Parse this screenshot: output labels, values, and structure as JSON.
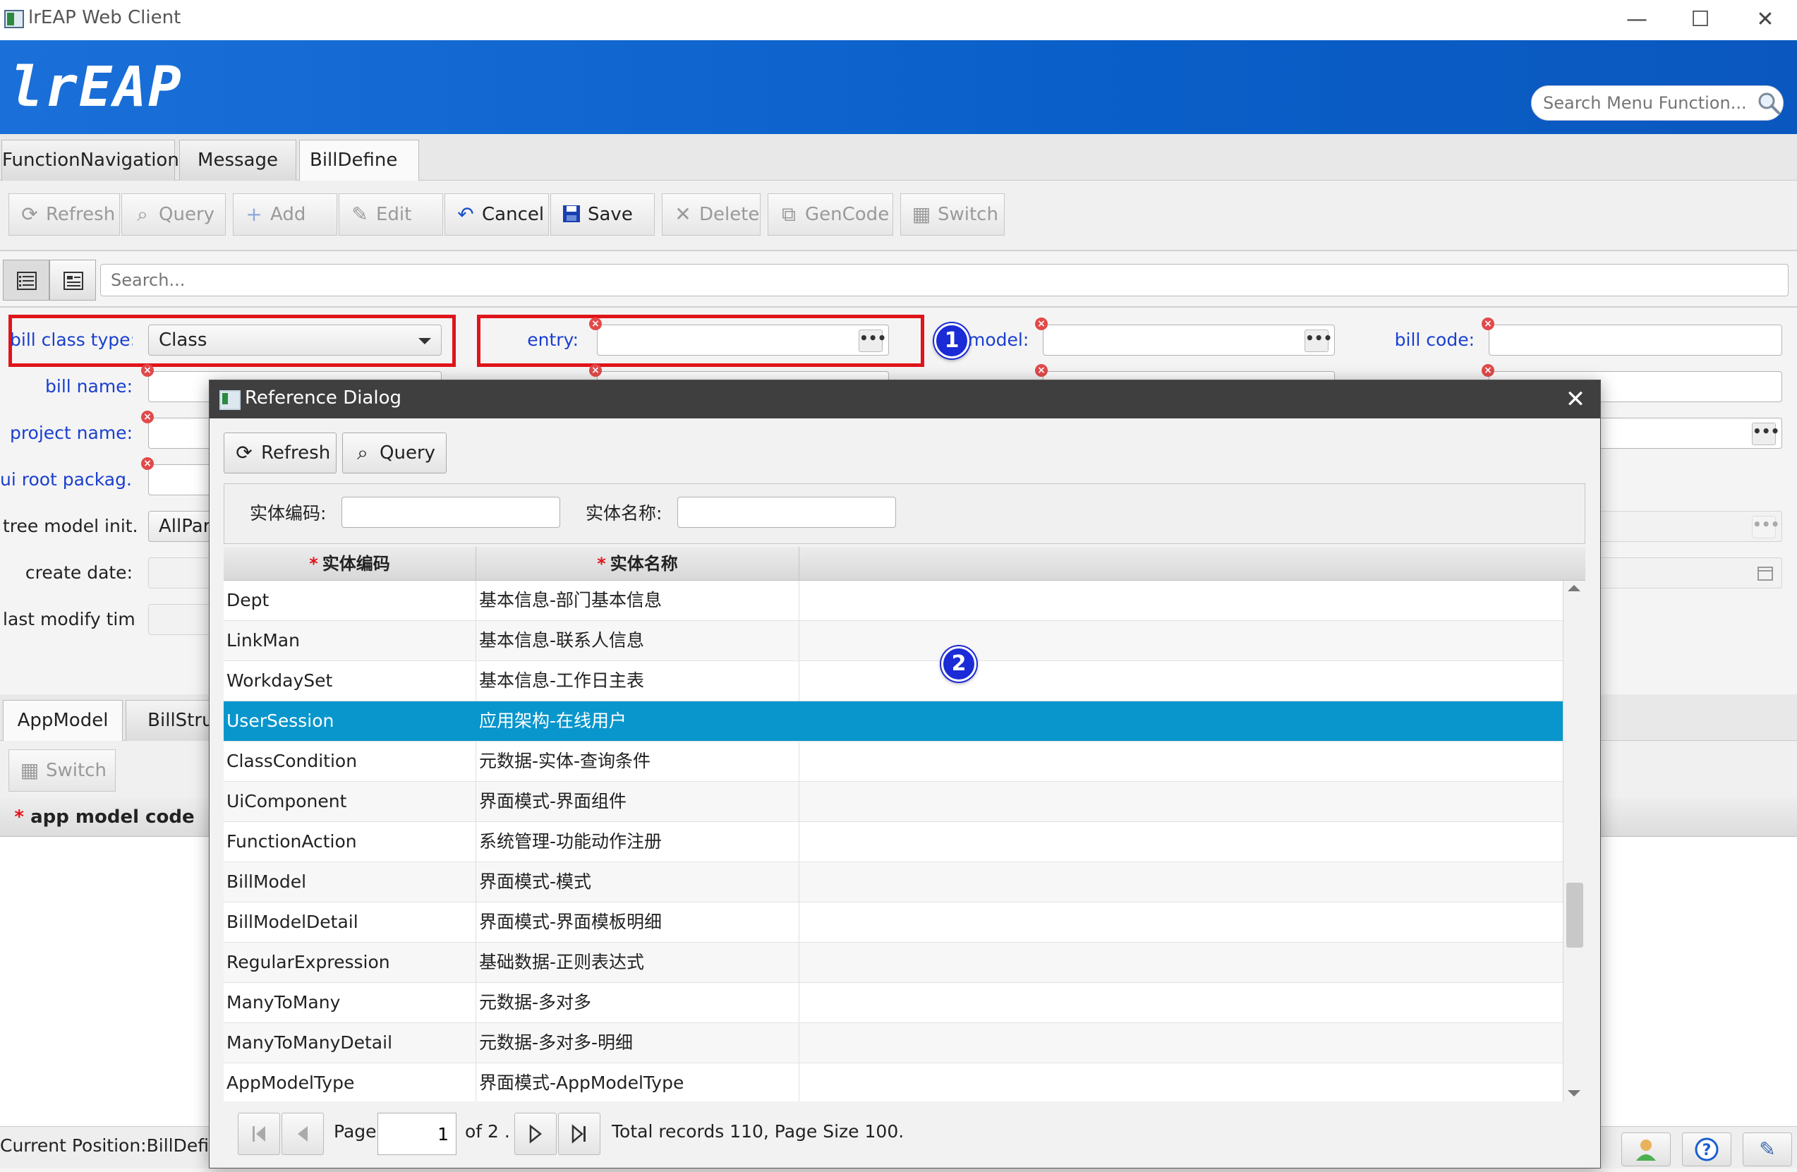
{
  "window": {
    "title": "lrEAP Web Client",
    "minimize": "—",
    "maximize": "☐",
    "close": "✕"
  },
  "header": {
    "logo": "lrEAP",
    "search_placeholder": "Search Menu Function..."
  },
  "tabs": [
    {
      "label": "FunctionNavigation"
    },
    {
      "label": "Message"
    },
    {
      "label": "BillDefine",
      "close": "✕"
    }
  ],
  "toolbar": {
    "refresh": "Refresh",
    "query": "Query",
    "add": "Add",
    "edit": "Edit",
    "cancel": "Cancel",
    "save": "Save",
    "delete": "Delete",
    "gencode": "GenCode",
    "switch": "Switch"
  },
  "search": {
    "placeholder": "Search..."
  },
  "form": {
    "bill_class_type_label": "bill class type:",
    "bill_class_type_value": "Class",
    "entry_label": "entry:",
    "model_label": "model:",
    "bill_code_label": "bill code:",
    "bill_name_label": "bill name:",
    "project_name_label": "project name:",
    "ui_root_package_label": "ui root packag...",
    "tree_model_init_label": "tree model init...",
    "tree_model_init_value": "AllPare",
    "create_date_label": "create date:",
    "last_modify_time_label": "last modify tim...",
    "ellipsis": "•••",
    "error_mark": "×"
  },
  "callouts": {
    "one": "1",
    "two": "2"
  },
  "subtabs": [
    {
      "label": "AppModel"
    },
    {
      "label": "BillStruc"
    }
  ],
  "subtoolbar": {
    "switch": "Switch"
  },
  "appgrid": {
    "required_mark": "*",
    "col_app_model_code": "app model code"
  },
  "status": {
    "position": "Current Position:BillDefine"
  },
  "dialog": {
    "title": "Reference Dialog",
    "close": "✕",
    "refresh": "Refresh",
    "query": "Query",
    "filter_code_label": "实体编码:",
    "filter_name_label": "实体名称:",
    "col_code": "实体编码",
    "col_name": "实体名称",
    "required_mark": "*",
    "rows": [
      {
        "code": "Dept",
        "name": "基本信息-部门基本信息"
      },
      {
        "code": "LinkMan",
        "name": "基本信息-联系人信息"
      },
      {
        "code": "WorkdaySet",
        "name": "基本信息-工作日主表"
      },
      {
        "code": "UserSession",
        "name": "应用架构-在线用户"
      },
      {
        "code": "ClassCondition",
        "name": "元数据-实体-查询条件"
      },
      {
        "code": "UiComponent",
        "name": "界面模式-界面组件"
      },
      {
        "code": "FunctionAction",
        "name": "系统管理-功能动作注册"
      },
      {
        "code": "BillModel",
        "name": "界面模式-模式"
      },
      {
        "code": "BillModelDetail",
        "name": "界面模式-界面模板明细"
      },
      {
        "code": "RegularExpression",
        "name": "基础数据-正则表达式"
      },
      {
        "code": "ManyToMany",
        "name": "元数据-多对多"
      },
      {
        "code": "ManyToManyDetail",
        "name": "元数据-多对多-明细"
      },
      {
        "code": "AppModelType",
        "name": "界面模式-AppModelType"
      }
    ],
    "selected_index": 3,
    "pager": {
      "page_label": "Page",
      "page_value": "1",
      "of_label": "of 2 .",
      "total": "Total records  110, Page Size 100."
    }
  },
  "colors": {
    "header_blue": "#0a5fc8",
    "selection": "#0996cc",
    "label_blue": "#1a3fcf",
    "highlight_red": "#e0141a",
    "callout_blue": "#1b2bd6"
  }
}
